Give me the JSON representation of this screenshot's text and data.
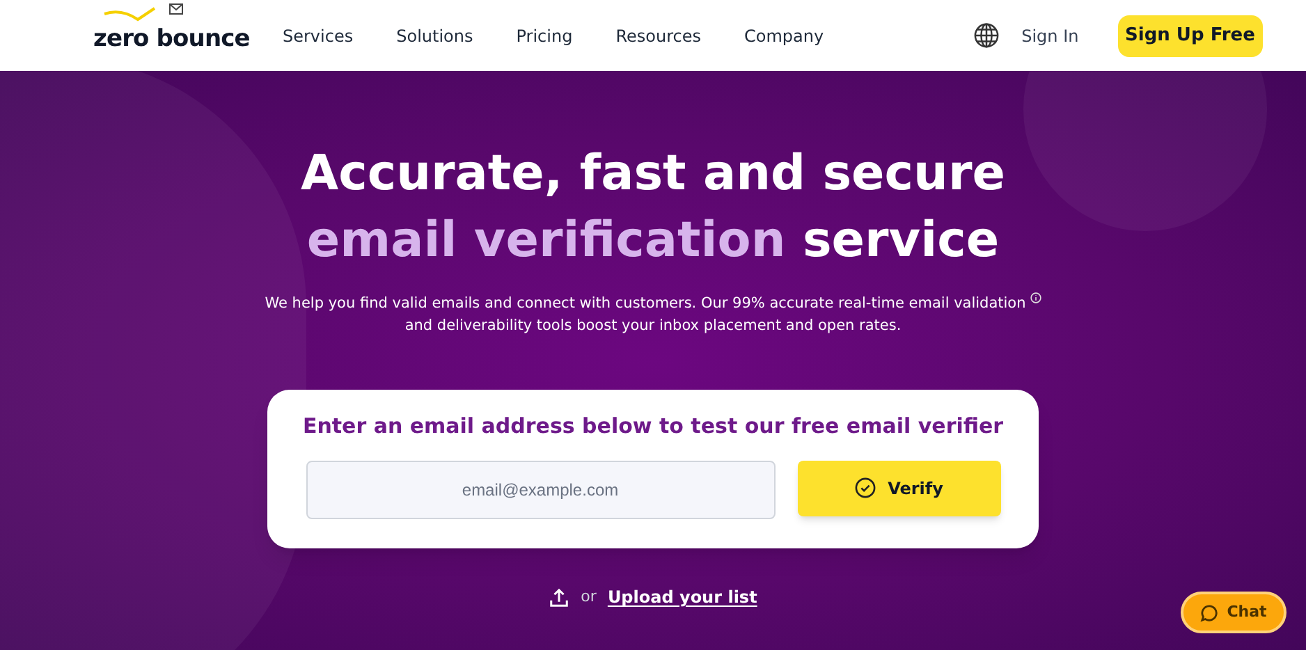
{
  "header": {
    "logo": "zero bounce",
    "nav": [
      {
        "label": "Services"
      },
      {
        "label": "Solutions"
      },
      {
        "label": "Pricing"
      },
      {
        "label": "Resources"
      },
      {
        "label": "Company"
      }
    ],
    "sign_in": "Sign In",
    "sign_up": "Sign Up Free"
  },
  "hero": {
    "headline_line1": "Accurate, fast and secure",
    "headline_line2": [
      {
        "text": "email verification",
        "highlight": true
      },
      {
        "text": "service",
        "highlight": false
      }
    ],
    "description_lines": [
      "We help you find valid emails and connect with customers. Our 99% accurate real-time email validation",
      "and deliverability tools boost your inbox placement and open rates."
    ]
  },
  "verify_card": {
    "title": "Enter an email address below to test our free email verifier",
    "placeholder": "email@example.com",
    "button": "Verify"
  },
  "upload": {
    "prefix": "or",
    "link": "Upload your list"
  },
  "chat": {
    "label": "Chat"
  }
}
